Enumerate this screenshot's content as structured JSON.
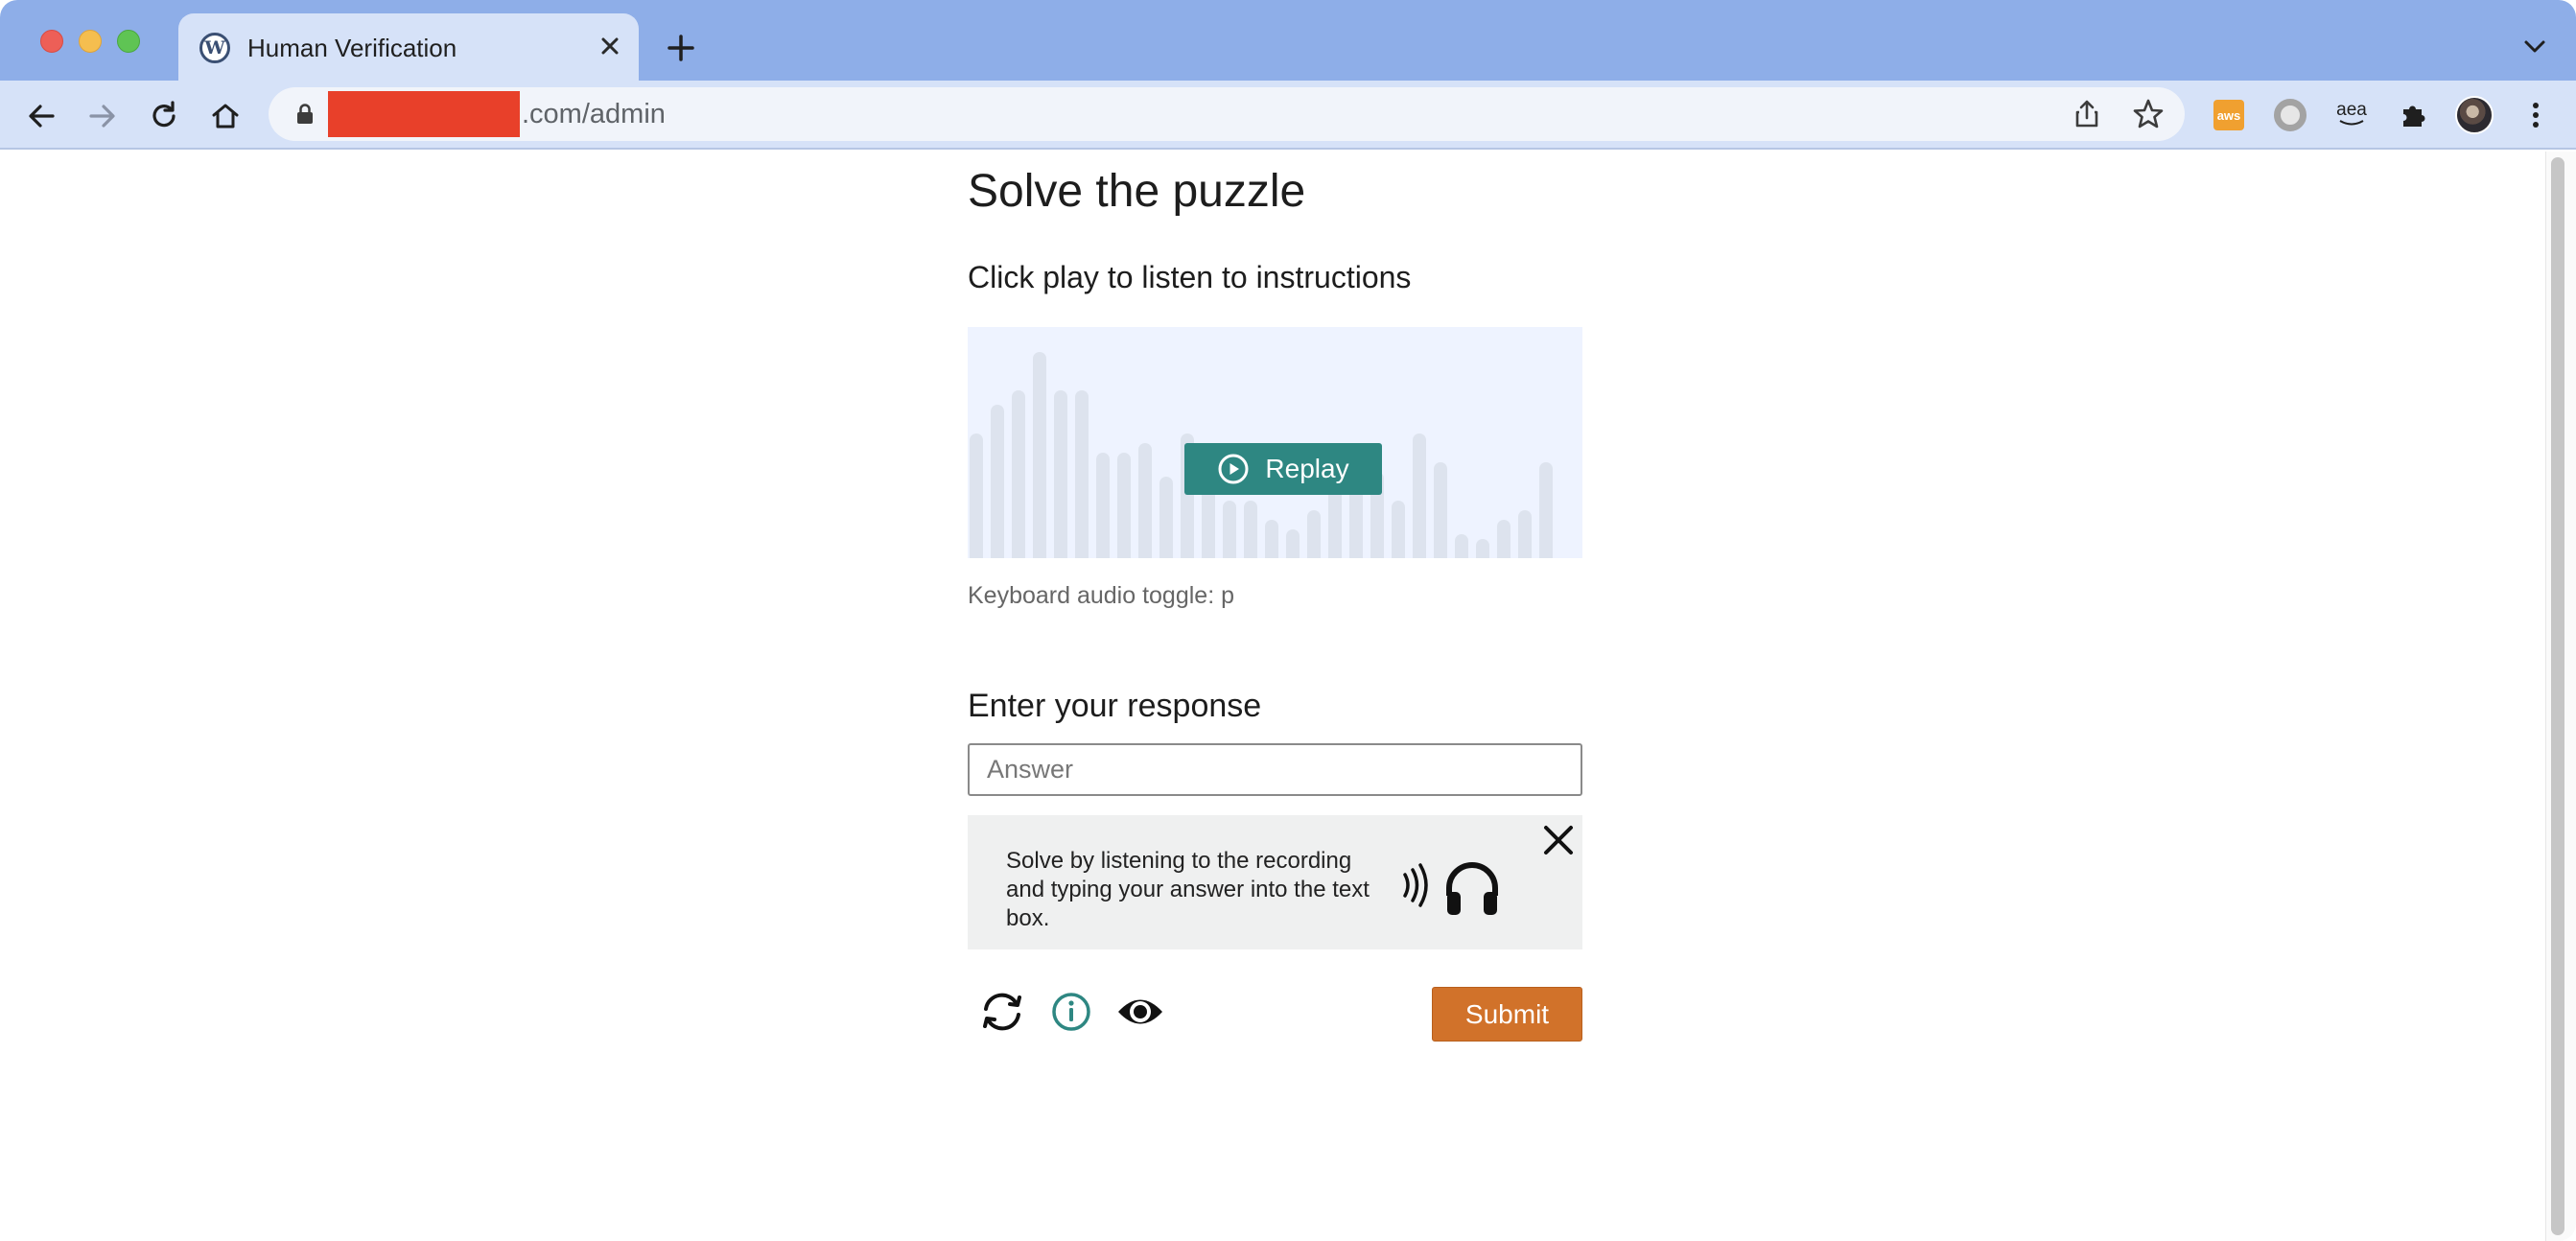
{
  "browser": {
    "tab_title": "Human Verification",
    "url_suffix": ".com/admin"
  },
  "page": {
    "heading": "Solve the puzzle",
    "instructions": "Click play to listen to instructions",
    "replay_label": "Replay",
    "keyboard_hint": "Keyboard audio toggle: p",
    "response_heading": "Enter your response",
    "answer_placeholder": "Answer",
    "help_text": "Solve by listening to the recording and typing your answer into the text box.",
    "submit_label": "Submit"
  },
  "colors": {
    "tabbar": "#8eaee8",
    "toolbar": "#d6e2f8",
    "replay_button": "#2e8782",
    "submit_button": "#d1722a",
    "audio_background": "#eef3ff",
    "help_background": "#eff0f0",
    "redaction": "#e8402a"
  },
  "icons": {
    "controls": [
      "refresh-icon",
      "info-icon",
      "eye-icon"
    ],
    "extensions": [
      "aws-extension-icon",
      "circle-extension-icon",
      "amazon-assoc-extension-icon",
      "puzzle-extensions-icon",
      "profile-avatar"
    ]
  },
  "extensions": {
    "aws_label": "aws",
    "aea_label": "aea"
  }
}
